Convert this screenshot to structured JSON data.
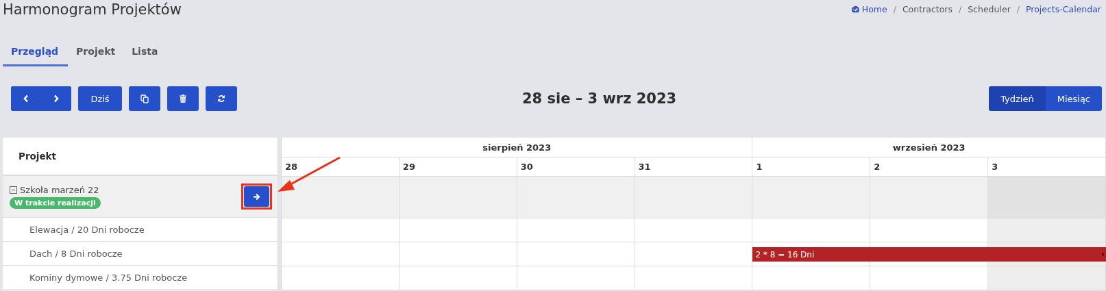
{
  "page_title": "Harmonogram Projektów",
  "breadcrumb": [
    {
      "label": "Home",
      "kind": "home"
    },
    {
      "separator": "/",
      "label": "Contractors",
      "kind": "plain"
    },
    {
      "separator": "/",
      "label": "Scheduler",
      "kind": "plain"
    },
    {
      "separator": "/",
      "label": "Projects-Calendar",
      "kind": "link"
    }
  ],
  "tabs": [
    {
      "label": "Przegląd",
      "selected": true
    },
    {
      "label": "Projekt",
      "selected": false
    },
    {
      "label": "Lista",
      "selected": false
    }
  ],
  "toolbar": [
    {
      "kind": "prev-next"
    },
    {
      "kind": "text",
      "label": "Dziś"
    },
    {
      "kind": "copy"
    },
    {
      "kind": "delete"
    },
    {
      "kind": "refresh"
    }
  ],
  "date_range": "28 sie – 3 wrz 2023",
  "views": [
    {
      "label": "Tydzień",
      "selected": true
    },
    {
      "label": "Miesiąc",
      "selected": false
    }
  ],
  "resource_header": "Projekt",
  "months": [
    {
      "label": "sierpień 2023",
      "days": [
        {
          "label": "28",
          "weekend": false
        },
        {
          "label": "29",
          "weekend": false
        },
        {
          "label": "30",
          "weekend": false
        },
        {
          "label": "31",
          "weekend": false
        }
      ]
    },
    {
      "label": "wrzesień 2023",
      "days": [
        {
          "label": "1",
          "weekend": false
        },
        {
          "label": "2",
          "weekend": false
        },
        {
          "label": "3",
          "weekend": true
        }
      ]
    }
  ],
  "project": {
    "name": "Szkoła marzeń 22",
    "expanded": true,
    "status": "W trakcie realizacji",
    "highlighted": true
  },
  "tasks": [
    {
      "name": "Elewacja / 20 Dni robocze"
    },
    {
      "name": "Dach / 8 Dni robocze",
      "bar": {
        "label": "2 * 8 = 16 Dni",
        "color": "#b52225",
        "covered_days": [
          false,
          false,
          false,
          false,
          true,
          true,
          true
        ],
        "continues": true
      }
    },
    {
      "name": "Kominy dymowe / 3.75 Dni robocze"
    }
  ]
}
